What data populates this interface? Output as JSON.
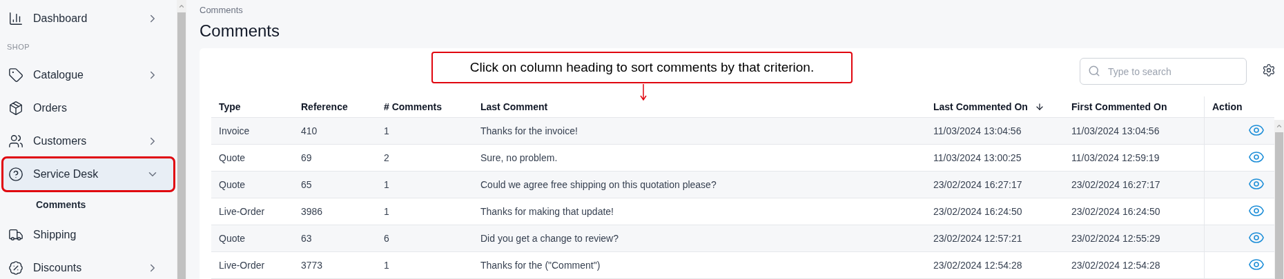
{
  "sidebar": {
    "items": [
      {
        "kind": "group",
        "label": "Dashboard",
        "expanded": false,
        "selected": false,
        "highlighted": false
      },
      {
        "kind": "section",
        "label": "SHOP"
      },
      {
        "kind": "group",
        "label": "Catalogue",
        "expanded": false,
        "selected": false,
        "highlighted": false
      },
      {
        "kind": "link",
        "label": "Orders",
        "selected": false,
        "highlighted": false
      },
      {
        "kind": "group",
        "label": "Customers",
        "expanded": false,
        "selected": false,
        "highlighted": false
      },
      {
        "kind": "group",
        "label": "Service Desk",
        "expanded": true,
        "selected": true,
        "highlighted": true,
        "children": [
          {
            "label": "Comments",
            "selected": true
          }
        ]
      },
      {
        "kind": "link",
        "label": "Shipping",
        "selected": false,
        "highlighted": false
      },
      {
        "kind": "group",
        "label": "Discounts",
        "expanded": false,
        "selected": false,
        "highlighted": false
      }
    ]
  },
  "breadcrumb": "Comments",
  "page_title": "Comments",
  "annotation": {
    "text": "Click on column heading to sort comments by that criterion."
  },
  "search": {
    "placeholder": "Type to search"
  },
  "table": {
    "columns": [
      {
        "label": "Type",
        "kind": "text",
        "sorted": false
      },
      {
        "label": "Reference",
        "kind": "text",
        "sorted": false
      },
      {
        "label": "# Comments",
        "kind": "text",
        "sorted": false
      },
      {
        "label": "Last Comment",
        "kind": "text",
        "sorted": false
      },
      {
        "label": "Last Commented On",
        "kind": "text",
        "sorted": true
      },
      {
        "label": "First Commented On",
        "kind": "text",
        "sorted": false
      },
      {
        "label": "Action",
        "kind": "action",
        "sorted": false
      }
    ],
    "rows": [
      [
        "Invoice",
        "410",
        "1",
        "Thanks for the invoice!",
        "11/03/2024 13:04:56",
        "11/03/2024 13:04:56"
      ],
      [
        "Quote",
        "69",
        "2",
        "Sure, no problem.",
        "11/03/2024 13:00:25",
        "11/03/2024 12:59:19"
      ],
      [
        "Quote",
        "65",
        "1",
        "Could we agree free shipping on this quotation please?",
        "23/02/2024 16:27:17",
        "23/02/2024 16:27:17"
      ],
      [
        "Live-Order",
        "3986",
        "1",
        "Thanks for making that update!",
        "23/02/2024 16:24:50",
        "23/02/2024 16:24:50"
      ],
      [
        "Quote",
        "63",
        "6",
        "Did you get a change to review?",
        "23/02/2024 12:57:21",
        "23/02/2024 12:55:29"
      ],
      [
        "Live-Order",
        "3773",
        "1",
        "Thanks for the (\"Comment\")",
        "23/02/2024 12:54:28",
        "23/02/2024 12:54:28"
      ]
    ]
  }
}
